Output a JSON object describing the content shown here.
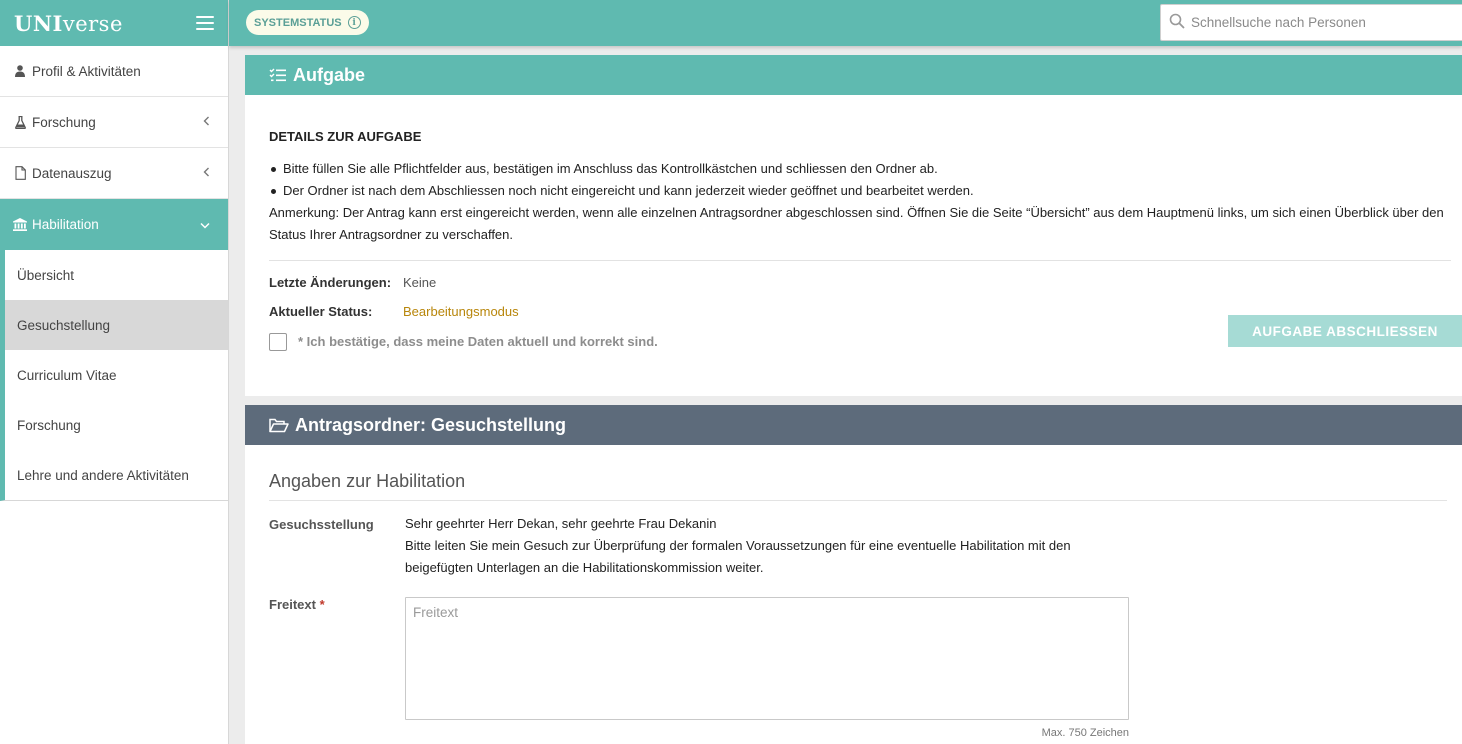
{
  "brand": {
    "logo_bold": "UNI",
    "logo_rest": "verse"
  },
  "sidebar": {
    "items": [
      {
        "label": "Profil & Aktivitäten",
        "icon": "user-icon"
      },
      {
        "label": "Forschung",
        "icon": "flask-icon"
      },
      {
        "label": "Datenauszug",
        "icon": "file-icon"
      },
      {
        "label": "Habilitation",
        "icon": "institution-icon"
      }
    ],
    "subitems": [
      {
        "label": "Übersicht"
      },
      {
        "label": "Gesuchstellung"
      },
      {
        "label": "Curriculum Vitae"
      },
      {
        "label": "Forschung"
      },
      {
        "label": "Lehre und andere Aktivitäten"
      }
    ]
  },
  "topbar": {
    "system_status": "SYSTEMSTATUS",
    "search_placeholder": "Schnellsuche nach Personen"
  },
  "task": {
    "header": "Aufgabe",
    "details_title": "DETAILS ZUR AUFGABE",
    "bullets": [
      "Bitte füllen Sie alle Pflichtfelder aus, bestätigen im Anschluss das Kontrollkästchen und schliessen den Ordner ab.",
      "Der Ordner ist nach dem Abschliessen noch nicht eingereicht und kann jederzeit wieder geöffnet und bearbeitet werden."
    ],
    "remark": "Anmerkung: Der Antrag kann erst eingereicht werden, wenn alle einzelnen Antragsordner abgeschlossen sind. Öffnen Sie die Seite “Übersicht” aus dem Hauptmenü links, um sich einen Überblick über den Status Ihrer Antragsordner zu verschaffen.",
    "last_changes_label": "Letzte Änderungen:",
    "last_changes_value": "Keine",
    "status_label": "Aktueller Status:",
    "status_value": "Bearbeitungsmodus",
    "status_color": "#b8860b",
    "confirm_label": "* Ich bestätige, dass meine Daten aktuell und korrekt sind.",
    "close_button": "AUFGABE ABSCHLIESSEN"
  },
  "folder": {
    "header": "Antragsordner: Gesuchstellung",
    "section_title": "Angaben zur Habilitation",
    "request_label": "Gesuchsstellung",
    "request_line1": "Sehr geehrter Herr Dekan, sehr geehrte Frau Dekanin",
    "request_line2": "Bitte leiten Sie mein Gesuch zur Überprüfung der formalen Voraussetzungen für eine eventuelle Habilitation mit den beigefügten Unterlagen an die Habilitationskommission weiter.",
    "freetext_label": "Freitext",
    "freetext_required": "*",
    "freetext_placeholder": "Freitext",
    "freetext_value": "",
    "max_chars": "Max. 750 Zeichen"
  },
  "colors": {
    "accent": "#5fbab0",
    "folder_header": "#5d6b7b",
    "button_disabled": "#a6dbd5"
  }
}
